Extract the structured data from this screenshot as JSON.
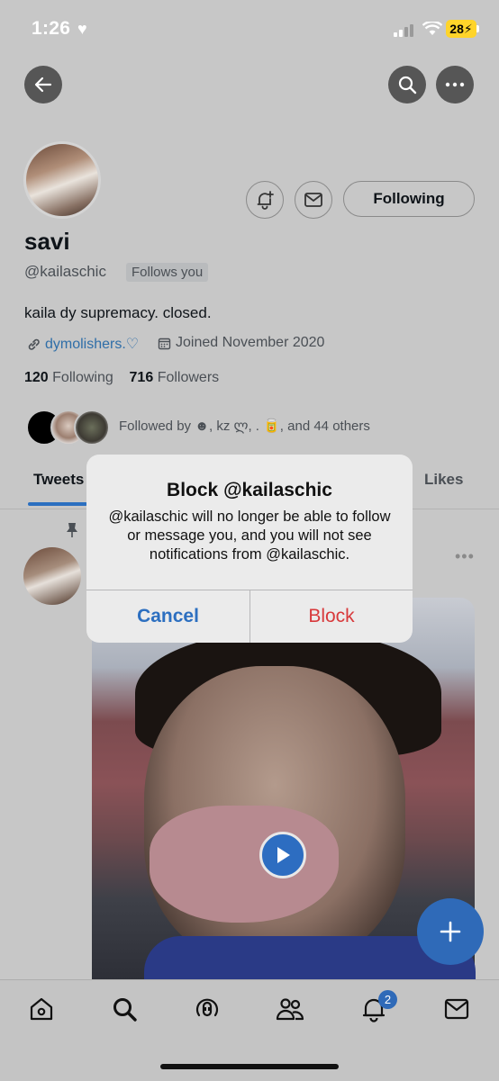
{
  "status_bar": {
    "time": "1:26",
    "battery": "28"
  },
  "profile": {
    "name": "savi",
    "handle": "@kailaschic",
    "follows_you_badge": "Follows you",
    "bio": "kaila dy supremacy. closed.",
    "link": "dymolishers.♡",
    "joined": "Joined November 2020",
    "following_count": "120",
    "following_label": "Following",
    "followers_count": "716",
    "followers_label": "Followers",
    "followed_by": "Followed by ☻, kz ლ, . 🥫, and 44 others",
    "following_button": "Following"
  },
  "tabs": {
    "tweets": "Tweets",
    "likes": "Likes"
  },
  "dialog": {
    "title": "Block @kailaschic",
    "message": "@kailaschic will no longer be able to follow or message you, and you will not see notifications from @kailaschic.",
    "cancel": "Cancel",
    "confirm": "Block"
  },
  "bottom_nav": {
    "notifications_badge": "2"
  },
  "colors": {
    "accent": "#2f6ab8",
    "destructive": "#d8393b",
    "link": "#2f6ea8"
  },
  "icons": [
    "back-arrow-icon",
    "search-icon",
    "more-icon",
    "bell-plus-icon",
    "mail-icon",
    "link-icon",
    "calendar-icon",
    "pin-icon",
    "play-icon",
    "plus-icon",
    "home-icon",
    "spaces-icon",
    "communities-icon",
    "bell-icon"
  ]
}
